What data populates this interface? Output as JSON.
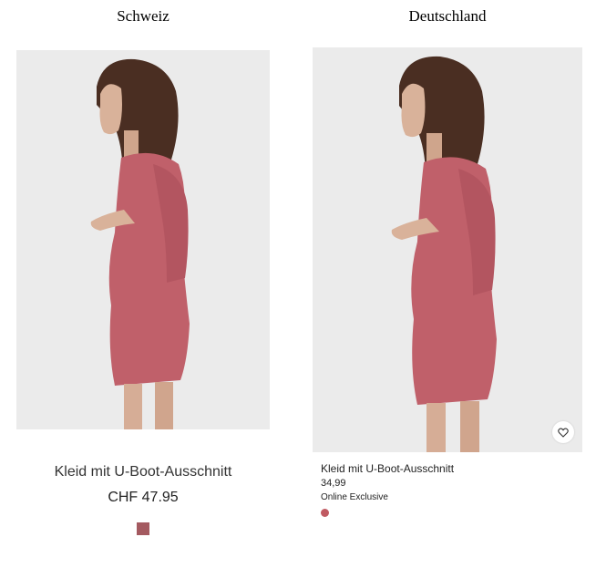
{
  "columns": [
    {
      "heading": "Schweiz",
      "product": {
        "name": "Kleid mit U-Boot-Ausschnitt",
        "price": "CHF 47.95",
        "color": "#a45a60"
      }
    },
    {
      "heading": "Deutschland",
      "product": {
        "name": "Kleid mit U-Boot-Ausschnitt",
        "price": "34,99",
        "badge": "Online Exclusive",
        "color": "#c05a62"
      }
    }
  ],
  "colors": {
    "photo_background": "#ebebeb",
    "dress": "#c0606a",
    "hair": "#4a2e22",
    "skin": "#d9b29a",
    "heart_icon": "#c98484"
  },
  "icons": {
    "favorite": "heart-icon"
  }
}
